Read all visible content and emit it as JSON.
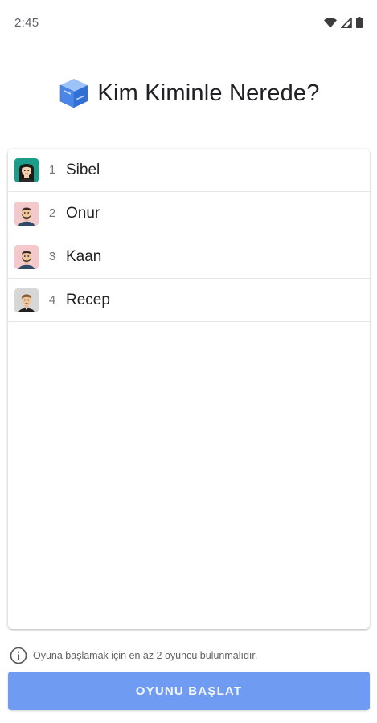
{
  "status_bar": {
    "time": "2:45",
    "icons": [
      "wifi-icon",
      "cellular-signal-icon",
      "battery-icon"
    ]
  },
  "header": {
    "app_icon": "cube-logo-icon",
    "title": "Kim Kiminle Nerede?"
  },
  "players": [
    {
      "number": "1",
      "name": "Sibel",
      "avatar": "woman-avatar-icon",
      "avatar_bg": "#1e9c8a"
    },
    {
      "number": "2",
      "name": "Onur",
      "avatar": "bearded-man-avatar-icon",
      "avatar_bg": "#f3c9cc"
    },
    {
      "number": "3",
      "name": "Kaan",
      "avatar": "bearded-man-avatar-icon",
      "avatar_bg": "#f3c9cc"
    },
    {
      "number": "4",
      "name": "Recep",
      "avatar": "man-avatar-icon",
      "avatar_bg": "#d7d7d7"
    }
  ],
  "info": {
    "icon": "info-icon",
    "text": "Oyuna başlamak için en az 2 oyuncu bulunmalıdır."
  },
  "start_button": {
    "label": "OYUNU BAŞLAT",
    "color": "#6f9cf2"
  }
}
